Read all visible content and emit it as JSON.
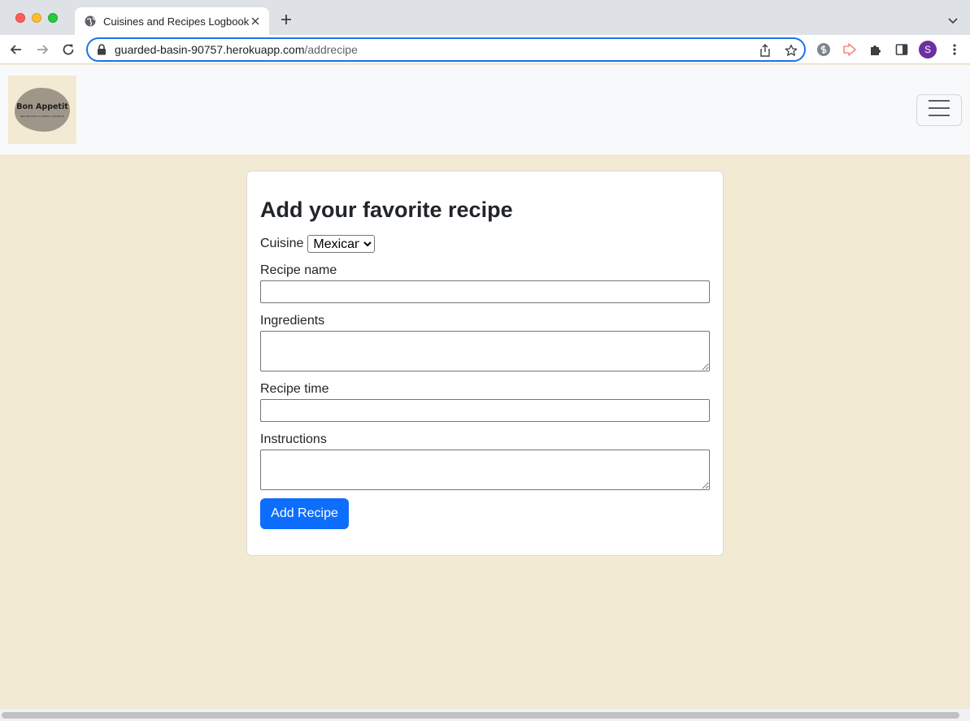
{
  "browser": {
    "tab_title": "Cuisines and Recipes Logbook",
    "url_host": "guarded-basin-90757.herokuapp.com",
    "url_path": "/addrecipe",
    "profile_initial": "S",
    "colors": {
      "omnibox_focus": "#1a73e8",
      "profile": "#6b2fa0"
    }
  },
  "navbar": {
    "logo_text": "Bon Appetit",
    "logo_subtext": "RECIPE AND CUISINES LOGBOOK"
  },
  "form": {
    "title": "Add your favorite recipe",
    "cuisine_label": "Cuisine",
    "cuisine_selected": "Mexican",
    "recipe_name_label": "Recipe name",
    "recipe_name_value": "",
    "ingredients_label": "Ingredients",
    "ingredients_value": "",
    "recipe_time_label": "Recipe time",
    "recipe_time_value": "",
    "instructions_label": "Instructions",
    "instructions_value": "",
    "submit_label": "Add Recipe",
    "colors": {
      "submit": "#0d6efd",
      "page_background": "#f3ead3"
    }
  }
}
